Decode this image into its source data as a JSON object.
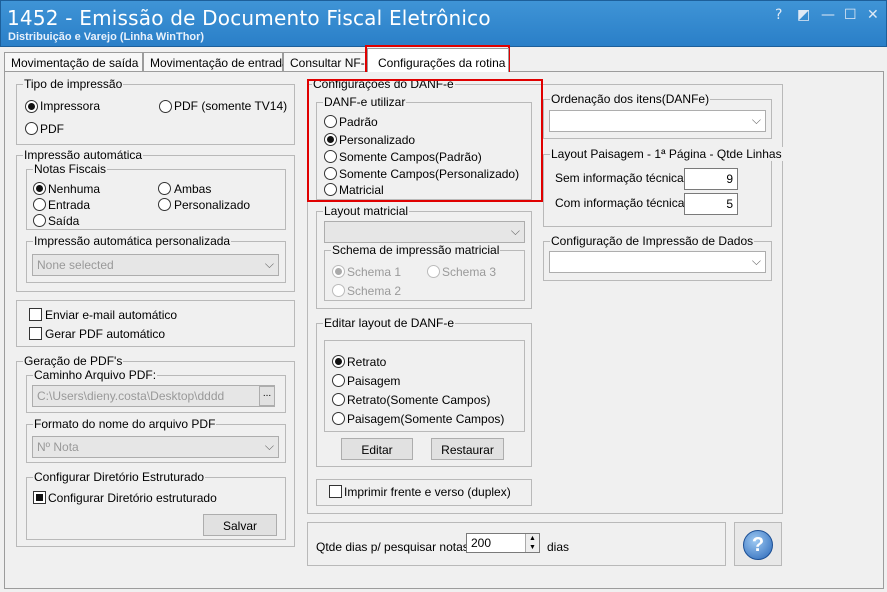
{
  "window": {
    "title": "1452 - Emissão de Documento Fiscal Eletrônico",
    "subtitle": "Distribuição e Varejo (Linha WinThor)",
    "help": "?",
    "restore": "◩",
    "minimize": "—",
    "maximize": "☐",
    "close": "✕"
  },
  "tabs": [
    "Movimentação de saída",
    "Movimentação de entrada",
    "Consultar NF-e",
    "Configurações da rotina"
  ],
  "tipo_impressao": {
    "title": "Tipo de impressão",
    "impressora": "Impressora",
    "pdf_tv14": "PDF (somente TV14)",
    "pdf": "PDF"
  },
  "impressao_auto": {
    "title": "Impressão automática",
    "notas": "Notas Fiscais",
    "nenhuma": "Nenhuma",
    "ambas": "Ambas",
    "entrada": "Entrada",
    "personalizado": "Personalizado",
    "saida": "Saída",
    "pers_title": "Impressão automática personalizada",
    "pers_value": "None selected"
  },
  "email": {
    "enviar": "Enviar e-mail automático",
    "gerar": "Gerar PDF automático"
  },
  "pdf": {
    "title": "Geração de PDF's",
    "caminho_title": "Caminho Arquivo PDF:",
    "caminho_value": "C:\\Users\\dieny.costa\\Desktop\\dddd",
    "browse": "...",
    "formato_title": "Formato do nome do arquivo PDF",
    "formato_value": "Nº Nota",
    "dir_title": "Configurar Diretório Estruturado",
    "dir_chk": "Configurar Diretório estruturado",
    "salvar": "Salvar"
  },
  "danfe": {
    "title": "Configurações do DANF-e",
    "utilizar": "DANF-e utilizar",
    "padrao": "Padrão",
    "personalizado": "Personalizado",
    "somente_padrao": "Somente Campos(Padrão)",
    "somente_pers": "Somente Campos(Personalizado)",
    "matricial": "Matricial"
  },
  "layout_matricial": {
    "title": "Layout matricial",
    "schema_title": "Schema de impressão matricial",
    "s1": "Schema 1",
    "s2": "Schema 2",
    "s3": "Schema 3"
  },
  "editar": {
    "title": "Editar layout de DANF-e",
    "retrato": "Retrato",
    "paisagem": "Paisagem",
    "retrato_sc": "Retrato(Somente Campos)",
    "paisagem_sc": "Paisagem(Somente Campos)",
    "editar": "Editar",
    "restaurar": "Restaurar"
  },
  "duplex": "Imprimir frente e verso (duplex)",
  "ordenacao": {
    "title": "Ordenação dos itens(DANFe)"
  },
  "paisagem": {
    "title": "Layout Paisagem - 1ª Página - Qtde Linhas",
    "sem": "Sem informação técnica",
    "sem_val": "9",
    "com": "Com informação técnica",
    "com_val": "5"
  },
  "config_dados": {
    "title": "Configuração de Impressão de Dados"
  },
  "qtde": {
    "label": "Qtde dias p/ pesquisar notas:",
    "value": "200",
    "unit": "dias"
  },
  "help_icon": "?"
}
